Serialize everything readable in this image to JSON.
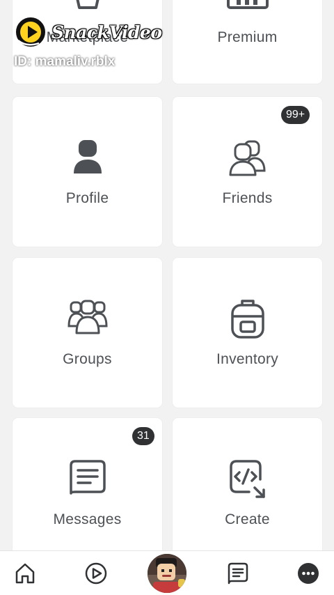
{
  "tiles": {
    "marketplace": {
      "label": "Marketplace",
      "icon": "marketplace-bag-icon"
    },
    "premium": {
      "label": "Premium",
      "icon": "premium-icon"
    },
    "profile": {
      "label": "Profile",
      "icon": "profile-person-icon"
    },
    "friends": {
      "label": "Friends",
      "icon": "friends-icon",
      "badge": "99+"
    },
    "groups": {
      "label": "Groups",
      "icon": "groups-icon"
    },
    "inventory": {
      "label": "Inventory",
      "icon": "backpack-icon"
    },
    "messages": {
      "label": "Messages",
      "icon": "message-icon",
      "badge": "31"
    },
    "create": {
      "label": "Create",
      "icon": "code-icon"
    }
  },
  "bottom_nav": {
    "items": [
      "home",
      "discover",
      "avatar",
      "chat",
      "more"
    ]
  },
  "watermark": {
    "brand": "SnackVideo",
    "id": "ID: mamaliv.rblx"
  },
  "colors": {
    "background": "#f2f2f3",
    "tile": "#ffffff",
    "label": "#4d5155",
    "badge": "#2f3133"
  }
}
